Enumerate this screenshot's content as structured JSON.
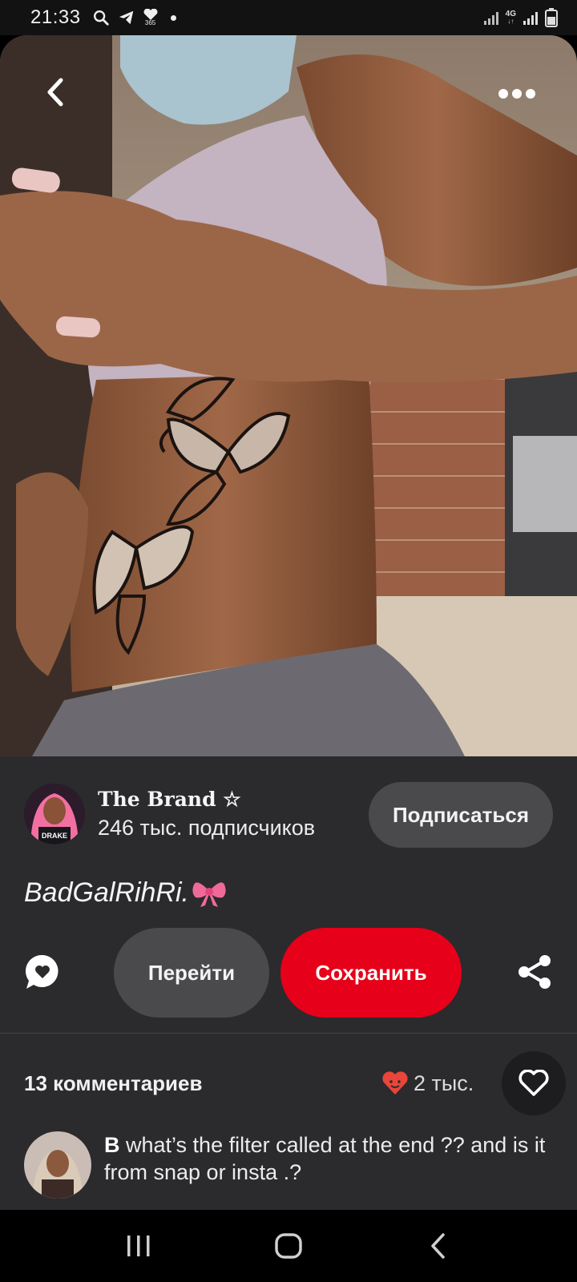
{
  "status_bar": {
    "time": "21:33",
    "left_icons": [
      "search-icon",
      "telegram-icon",
      "health-365-icon",
      "dot-icon"
    ],
    "health_badge": "365",
    "network_label": "4G",
    "right_icons": [
      "signal-icon",
      "4g-signal-icon",
      "signal-2-icon",
      "battery-icon"
    ]
  },
  "media": {
    "back_icon": "chevron-left-icon",
    "more_icon": "more-dots-icon"
  },
  "author": {
    "name": "The Brand ☆",
    "subscribers": "246 тыс. подписчиков",
    "follow_label": "Подписаться",
    "avatar_text": "DRAKE"
  },
  "pin": {
    "title": "BadGalRihRi.",
    "title_emoji": "bow-icon"
  },
  "actions": {
    "comment_icon": "comment-bubble-icon",
    "go_label": "Перейти",
    "save_label": "Сохранить",
    "share_icon": "share-icon"
  },
  "comments": {
    "count_label": "13 комментариев",
    "reaction_icon": "heart-face-emoji",
    "reactions_count": "2 тыс.",
    "like_icon": "heart-outline-icon",
    "items": [
      {
        "author": "B",
        "text": " what’s the filter called at the end ?? and is it from snap or insta .?"
      }
    ]
  },
  "nav_bar": {
    "recents_icon": "recents-icon",
    "home_icon": "home-icon",
    "back_icon": "back-icon"
  },
  "colors": {
    "panel_bg": "#2b2a2d",
    "save_red": "#e60019",
    "button_gray": "#4a494c",
    "heart_red": "#e9453a"
  }
}
